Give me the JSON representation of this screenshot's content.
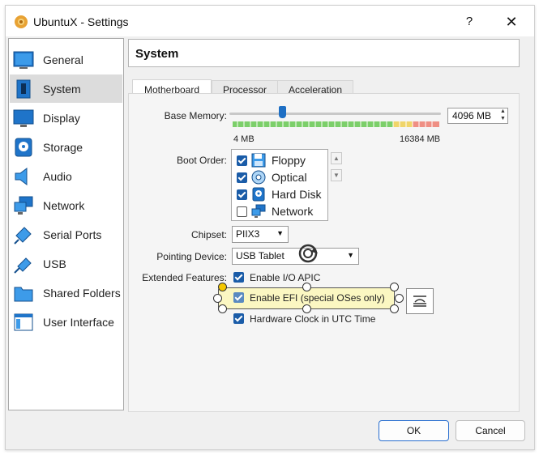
{
  "window": {
    "title": "UbuntuX - Settings",
    "help": "?",
    "close": "✕"
  },
  "sidebar": {
    "items": [
      {
        "label": "General",
        "icon": "general-icon"
      },
      {
        "label": "System",
        "icon": "system-icon",
        "active": true
      },
      {
        "label": "Display",
        "icon": "display-icon"
      },
      {
        "label": "Storage",
        "icon": "storage-icon"
      },
      {
        "label": "Audio",
        "icon": "audio-icon"
      },
      {
        "label": "Network",
        "icon": "network-icon"
      },
      {
        "label": "Serial Ports",
        "icon": "serial-ports-icon"
      },
      {
        "label": "USB",
        "icon": "usb-icon"
      },
      {
        "label": "Shared Folders",
        "icon": "shared-folders-icon"
      },
      {
        "label": "User Interface",
        "icon": "user-interface-icon"
      }
    ]
  },
  "page": {
    "title": "System"
  },
  "tabs": [
    {
      "label": "Motherboard",
      "active": true
    },
    {
      "label": "Processor"
    },
    {
      "label": "Acceleration"
    }
  ],
  "motherboard": {
    "base_memory": {
      "label": "Base Memory:",
      "value": "4096 MB",
      "min_label": "4 MB",
      "max_label": "16384 MB",
      "fraction": 0.25
    },
    "boot_order": {
      "label": "Boot Order:",
      "items": [
        {
          "label": "Floppy",
          "checked": true,
          "icon": "floppy-icon"
        },
        {
          "label": "Optical",
          "checked": true,
          "icon": "optical-disc-icon"
        },
        {
          "label": "Hard Disk",
          "checked": true,
          "icon": "hard-disk-icon"
        },
        {
          "label": "Network",
          "checked": false,
          "icon": "network-boot-icon"
        }
      ],
      "move_up": "▲",
      "move_down": "▼"
    },
    "chipset": {
      "label": "Chipset:",
      "value": "PIIX3"
    },
    "pointing_device": {
      "label": "Pointing Device:",
      "value": "USB Tablet"
    },
    "extended_features": {
      "label": "Extended Features:",
      "items": [
        {
          "label": "Enable I/O APIC",
          "checked": true
        },
        {
          "label": "Enable EFI (special OSes only)",
          "checked": true
        },
        {
          "label": "Hardware Clock in UTC Time",
          "checked": true
        }
      ]
    }
  },
  "buttons": {
    "ok": "OK",
    "cancel": "Cancel"
  },
  "colors": {
    "accent": "#1a5ca8",
    "highlight": "#fbf7c2",
    "active_item": "#dcdcdc"
  }
}
